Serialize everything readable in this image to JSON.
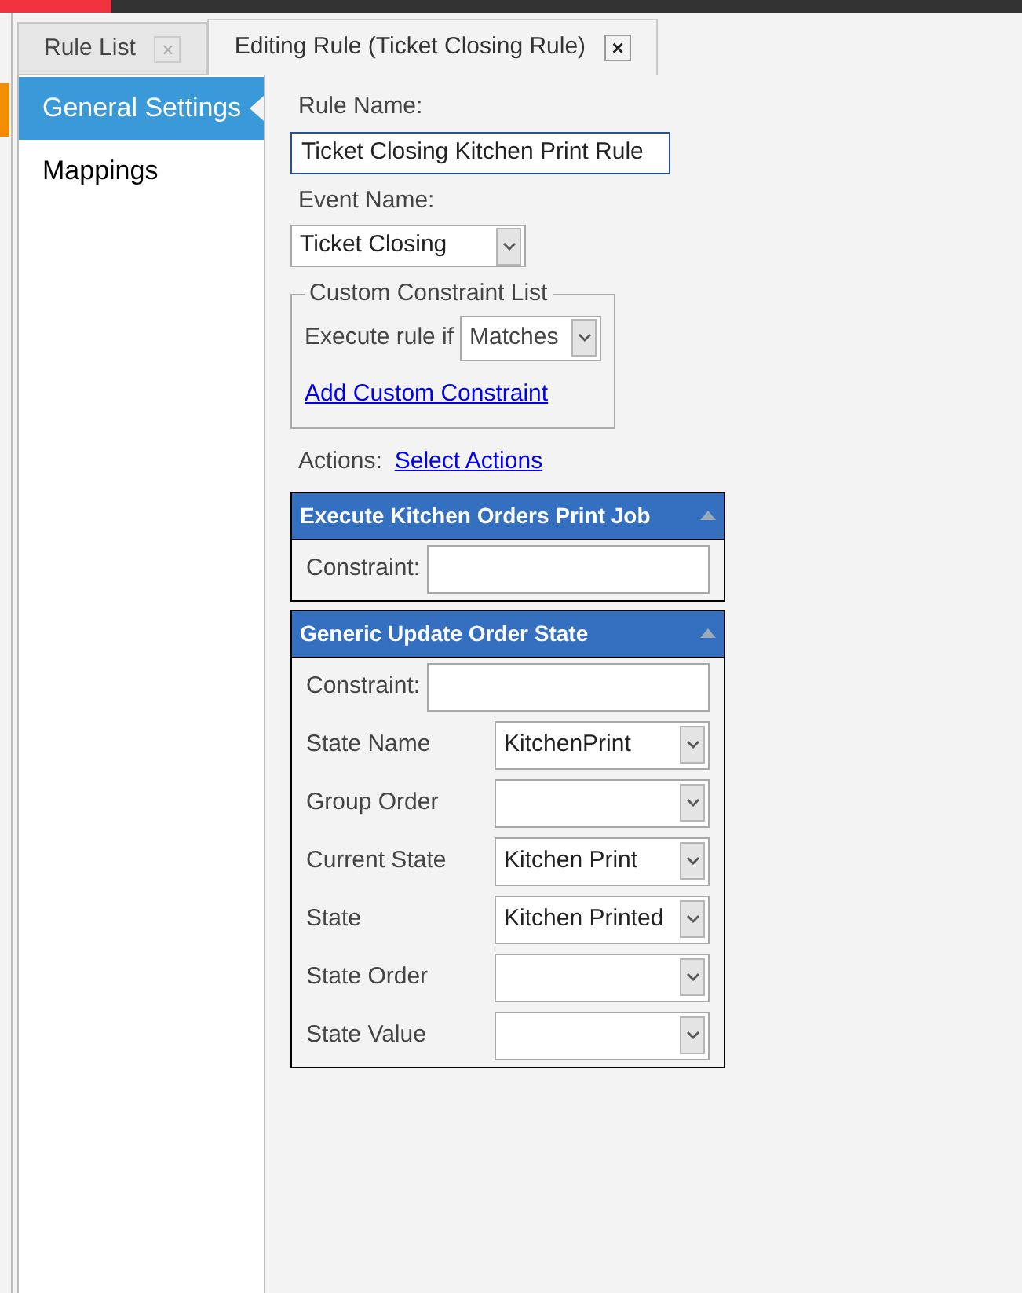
{
  "tabs": [
    {
      "label": "Rule List",
      "selected": false,
      "close": "×"
    },
    {
      "label": "Editing Rule (Ticket Closing Rule)",
      "selected": true,
      "close": "×"
    }
  ],
  "sidebar": {
    "items": [
      {
        "label": "General Settings",
        "selected": true
      },
      {
        "label": "Mappings",
        "selected": false
      }
    ]
  },
  "form": {
    "rule_name_label": "Rule Name:",
    "rule_name": "Ticket Closing Kitchen Print Rule",
    "event_name_label": "Event Name:",
    "event_name": "Ticket Closing",
    "constraint_list": {
      "legend": "Custom Constraint List",
      "execute_label": "Execute rule if",
      "execute_value": "Matches",
      "add_link": "Add Custom Constraint"
    },
    "actions_label": "Actions:",
    "select_actions_link": "Select Actions"
  },
  "actions": [
    {
      "title": "Execute Kitchen Orders Print Job",
      "fields": [
        {
          "kind": "text",
          "label": "Constraint:"
        }
      ]
    },
    {
      "title": "Generic Update Order State",
      "fields": [
        {
          "kind": "text",
          "label": "Constraint:"
        },
        {
          "kind": "select",
          "label": "State Name",
          "value": "KitchenPrint"
        },
        {
          "kind": "select",
          "label": "Group Order"
        },
        {
          "kind": "select",
          "label": "Current State",
          "value": "Kitchen Print"
        },
        {
          "kind": "select",
          "label": "State",
          "value": "Kitchen Printed"
        },
        {
          "kind": "select",
          "label": "State Order"
        },
        {
          "kind": "select",
          "label": "State Value"
        }
      ]
    }
  ]
}
